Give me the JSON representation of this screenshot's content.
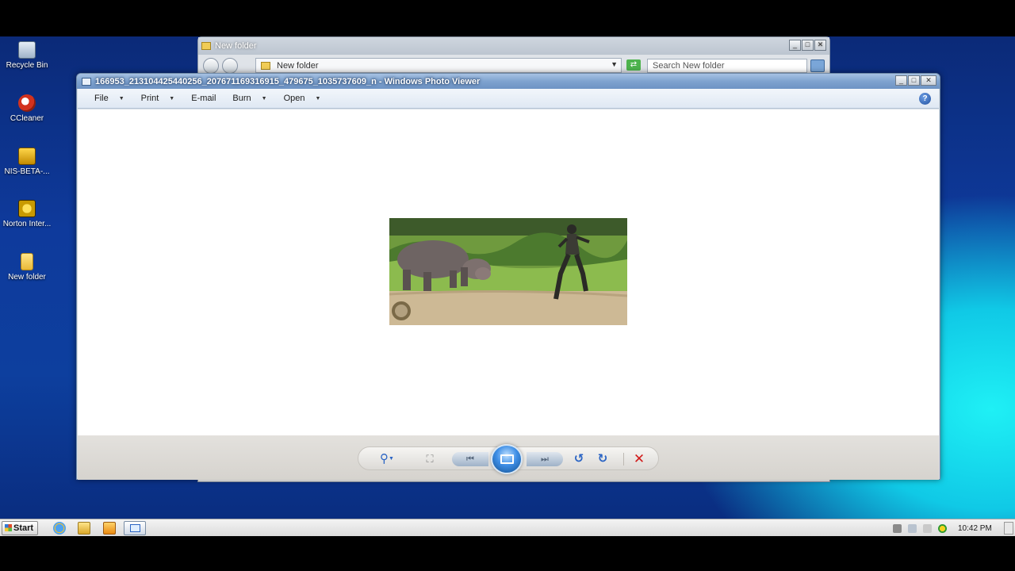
{
  "desktop": {
    "icons": [
      {
        "label": "Recycle Bin",
        "icon": "recycle-bin-icon"
      },
      {
        "label": "CCleaner",
        "icon": "ccleaner-icon"
      },
      {
        "label": "NIS-BETA-...",
        "icon": "installer-icon"
      },
      {
        "label": "Norton Inter...",
        "icon": "norton-icon"
      },
      {
        "label": "New folder",
        "icon": "folder-icon"
      }
    ]
  },
  "explorer": {
    "title": "New folder",
    "address": "New folder",
    "search_placeholder": "Search New folder",
    "caption": {
      "minimize": "_",
      "maximize": "□",
      "close": "✕"
    }
  },
  "viewer": {
    "title": "166953_213104425440256_207671169316915_479675_1035737609_n - Windows Photo Viewer",
    "caption": {
      "minimize": "_",
      "maximize": "□",
      "close": "✕"
    },
    "menu": [
      {
        "label": "File",
        "has_dropdown": true
      },
      {
        "label": "Print",
        "has_dropdown": true
      },
      {
        "label": "E-mail",
        "has_dropdown": false
      },
      {
        "label": "Burn",
        "has_dropdown": true
      },
      {
        "label": "Open",
        "has_dropdown": true
      }
    ],
    "help": "?",
    "toolbar": {
      "zoom": "⚲",
      "actual_size": "⛶",
      "previous": "⏮",
      "next": "⏭",
      "rotate_left": "↺",
      "rotate_right": "↻",
      "delete": "✕"
    }
  },
  "taskbar": {
    "start_label": "Start",
    "clock": "10:42 PM"
  },
  "colors": {
    "desktop_blue": "#0d3f9e",
    "desktop_cyan": "#1ff0f5",
    "title_blue": "#7fa3cf",
    "delete_red": "#d11b1b"
  }
}
